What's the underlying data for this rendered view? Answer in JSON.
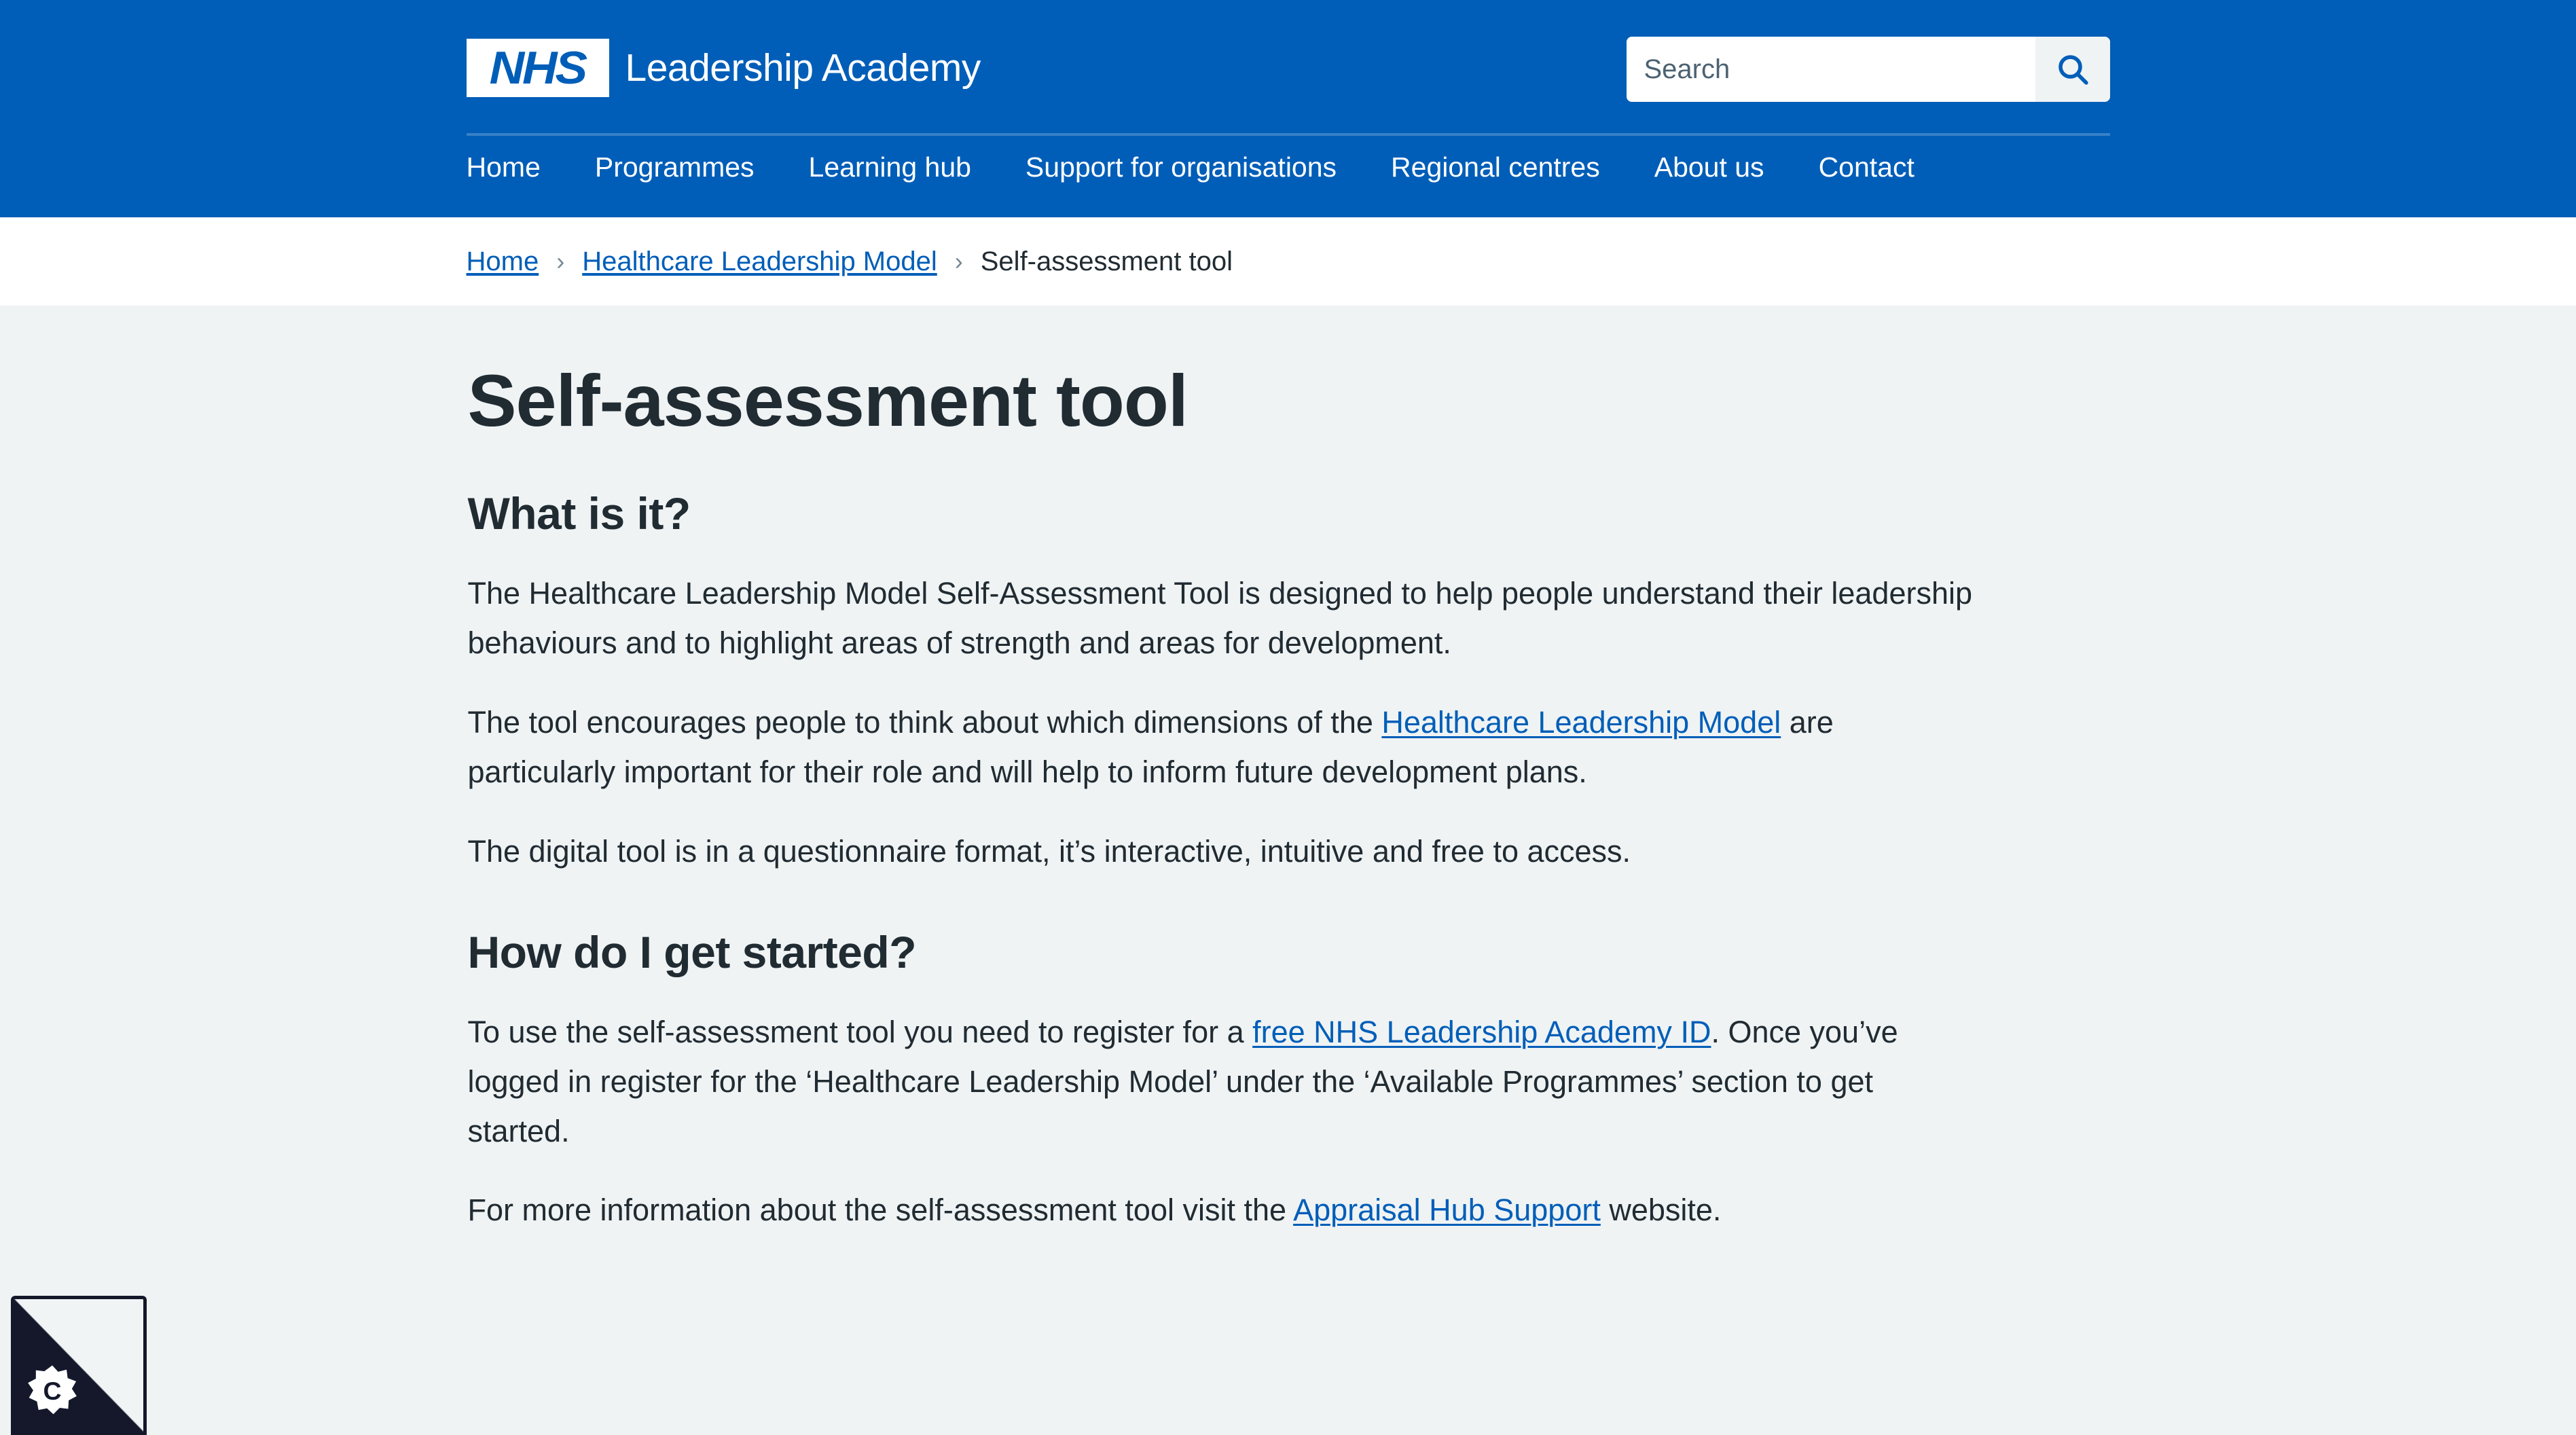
{
  "header": {
    "logo_text": "NHS",
    "brand_name": "Leadership Academy",
    "search": {
      "placeholder": "Search",
      "value": "",
      "button_label": "Search",
      "icon": "search-icon"
    },
    "nav": [
      {
        "label": "Home"
      },
      {
        "label": "Programmes"
      },
      {
        "label": "Learning hub"
      },
      {
        "label": "Support for organisations"
      },
      {
        "label": "Regional centres"
      },
      {
        "label": "About us"
      },
      {
        "label": "Contact"
      }
    ]
  },
  "breadcrumb": {
    "separator": "›",
    "items": [
      {
        "label": "Home",
        "current": false
      },
      {
        "label": "Healthcare Leadership Model",
        "current": false
      },
      {
        "label": "Self-assessment tool",
        "current": true
      }
    ]
  },
  "main": {
    "title": "Self-assessment tool",
    "sections": [
      {
        "heading": "What is it?",
        "paragraphs": [
          {
            "parts": [
              {
                "text": "The Healthcare Leadership Model Self-Assessment Tool is designed to help people understand their leadership behaviours and to highlight areas of strength and areas for development.",
                "link": false
              }
            ]
          },
          {
            "parts": [
              {
                "text": "The tool encourages people to think about which dimensions of the ",
                "link": false
              },
              {
                "text": "Healthcare Leadership Model",
                "link": true
              },
              {
                "text": " are particularly important for their role and will help to inform future development plans.",
                "link": false
              }
            ]
          },
          {
            "parts": [
              {
                "text": "The digital tool is in a questionnaire format, it’s interactive, intuitive and free to access.",
                "link": false
              }
            ]
          }
        ]
      },
      {
        "heading": "How do I get started?",
        "paragraphs": [
          {
            "parts": [
              {
                "text": "To use the self-assessment tool you need to register for a ",
                "link": false
              },
              {
                "text": "free NHS Leadership Academy ID",
                "link": true
              },
              {
                "text": ". Once you’ve logged in register for the ‘Healthcare Leadership Model’ under the ‘Available Programmes’ section to get started.",
                "link": false
              }
            ]
          },
          {
            "parts": [
              {
                "text": "For more information about the self-assessment tool visit the ",
                "link": false
              },
              {
                "text": "Appraisal Hub Support",
                "link": true
              },
              {
                "text": " website.",
                "link": false
              }
            ]
          }
        ]
      }
    ]
  },
  "cookie_widget": {
    "label": "C",
    "icon": "cookie-consent-icon"
  },
  "colors": {
    "nhs_blue": "#005eb8",
    "link_blue": "#005eb8",
    "text_dark": "#212b32",
    "page_bg": "#eff3f4",
    "breadcrumb_bg": "#ffffff",
    "cookie_dark": "#14182a"
  }
}
